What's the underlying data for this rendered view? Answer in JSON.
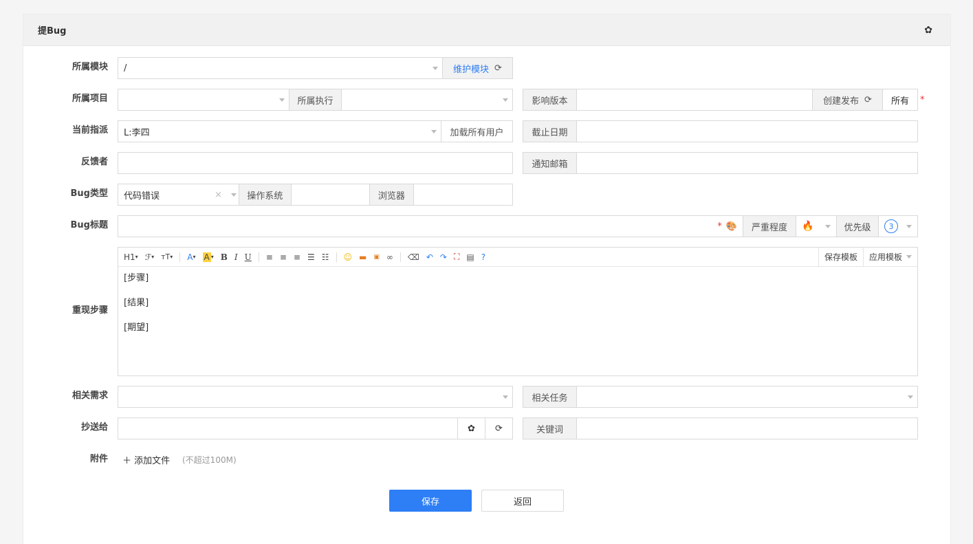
{
  "panel": {
    "title": "提Bug"
  },
  "labels": {
    "module": "所属模块",
    "project": "所属项目",
    "assignee": "当前指派",
    "feedback": "反馈者",
    "bug_type": "Bug类型",
    "bug_title": "Bug标题",
    "steps": "重现步骤",
    "story": "相关需求",
    "cc": "抄送给",
    "attachment": "附件"
  },
  "module": {
    "value": "/",
    "maintain_link": "维护模块"
  },
  "project": {
    "value": "",
    "execution_label": "所属执行",
    "execution_value": ""
  },
  "build": {
    "label": "影响版本",
    "create_release": "创建发布",
    "all": "所有",
    "required_mark": "*"
  },
  "assignee": {
    "value": "L:李四",
    "load_all": "加载所有用户"
  },
  "deadline": {
    "label": "截止日期",
    "value": ""
  },
  "notify_email": {
    "label": "通知邮箱",
    "value": ""
  },
  "bug_type": {
    "value": "代码错误",
    "os_label": "操作系统",
    "os_value": "",
    "browser_label": "浏览器",
    "browser_value": ""
  },
  "title": {
    "value": "",
    "required_mark": "*",
    "severity_label": "严重程度",
    "priority_label": "优先级",
    "priority_value": "3"
  },
  "toolbar": {
    "h1": "H1",
    "font": "ℱ",
    "size": "тT",
    "font_color": "A",
    "bg_color": "A",
    "bold": "B",
    "italic": "I",
    "underline": "U",
    "save_template": "保存模板",
    "apply_template": "应用模板"
  },
  "steps_content": {
    "steps": "[步骤]",
    "result": "[结果]",
    "expect": "[期望]"
  },
  "story": {
    "value": "",
    "task_label": "相关任务",
    "task_value": ""
  },
  "cc": {
    "value": "",
    "keywords_label": "关键词",
    "keywords_value": ""
  },
  "attachment": {
    "add": "添加文件",
    "note": "(不超过100M)"
  },
  "actions": {
    "save": "保存",
    "back": "返回"
  },
  "colors": {
    "primary": "#2e7ef5",
    "required": "#ee3333",
    "addon_bg": "#f2f2f2"
  }
}
